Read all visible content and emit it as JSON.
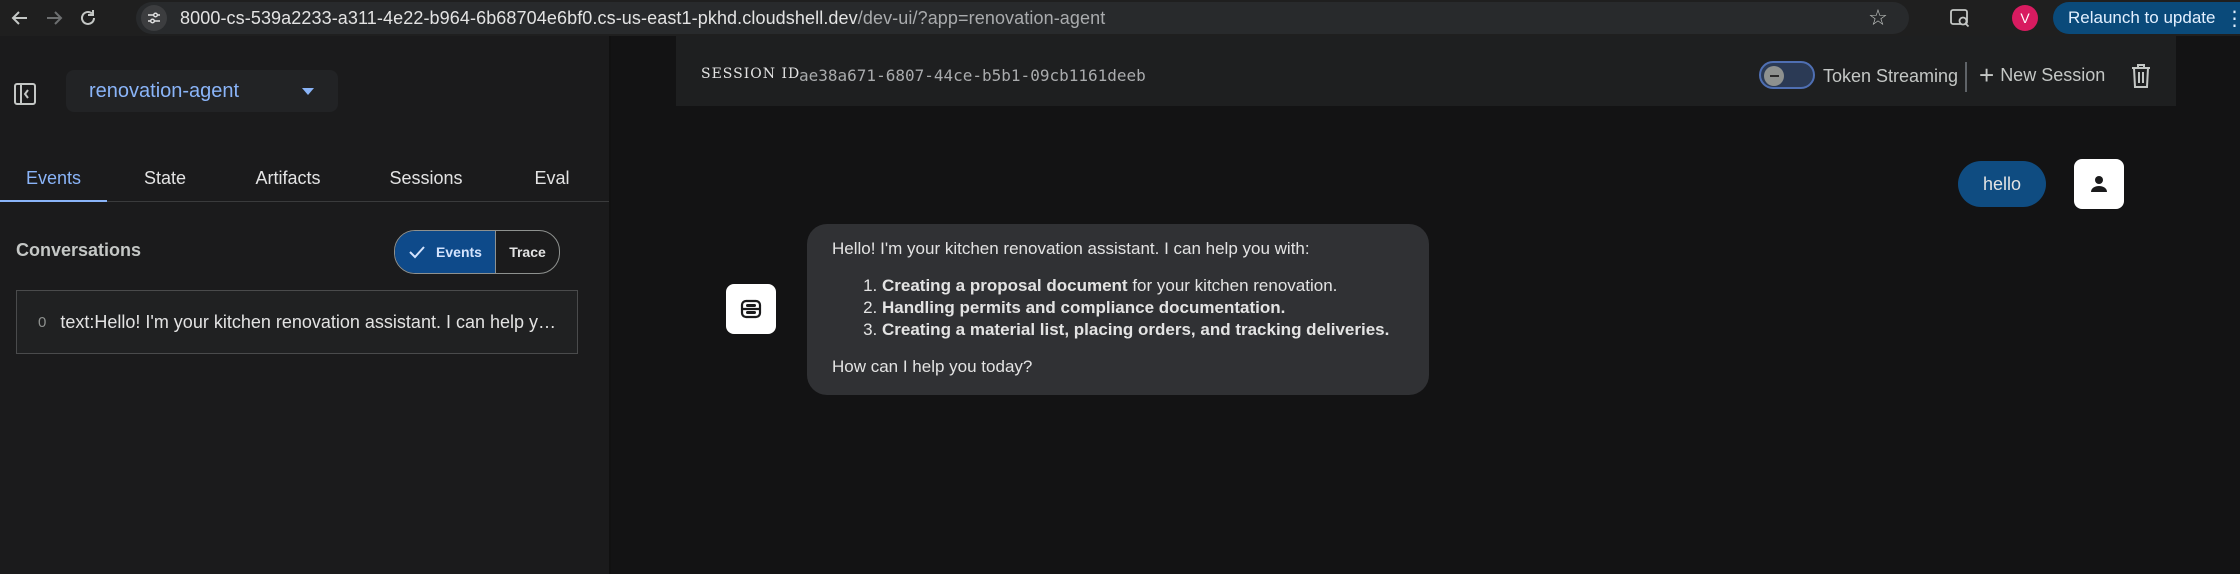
{
  "browser": {
    "url_host": "8000-cs-539a2233-a311-4e22-b964-6b68704e6bf0.cs-us-east1-pkhd.cloudshell.dev",
    "url_path": "/dev-ui/?app=renovation-agent",
    "profile_initial": "V",
    "relaunch_label": "Relaunch to update",
    "back_icon": "arrow-left-icon",
    "forward_icon": "arrow-right-icon",
    "reload_icon": "reload-icon",
    "bookmark_icon": "star-icon"
  },
  "sidebar": {
    "app_name": "renovation-agent",
    "tabs": [
      {
        "label": "Events"
      },
      {
        "label": "State"
      },
      {
        "label": "Artifacts"
      },
      {
        "label": "Sessions"
      },
      {
        "label": "Eval"
      }
    ],
    "conversations_title": "Conversations",
    "view_toggle": {
      "events_label": "Events",
      "trace_label": "Trace",
      "selected": "Events"
    },
    "conversation_items": [
      {
        "index": "0",
        "text": "text:Hello! I'm your kitchen renovation assistant. I can help you with:"
      }
    ]
  },
  "session": {
    "label": "SESSION ID",
    "id": "ae38a671-6807-44ce-b5b1-09cb1161deeb",
    "token_streaming_label": "Token Streaming",
    "token_streaming_enabled": false,
    "new_session_label": "New Session"
  },
  "chat": {
    "user_message": "hello",
    "bot": {
      "intro": "Hello! I'm your kitchen renovation assistant. I can help you with:",
      "items": [
        {
          "bold": "Creating a proposal document",
          "rest": " for your kitchen renovation."
        },
        {
          "bold": "Handling permits and compliance documentation.",
          "rest": ""
        },
        {
          "bold": "Creating a material list, placing orders, and tracking deliveries.",
          "rest": ""
        }
      ],
      "outro": "How can I help you today?"
    }
  },
  "colors": {
    "accent": "#8ab4f8",
    "user_bubble": "#0f4c81",
    "bot_bubble": "#303134",
    "background": "#131314"
  }
}
